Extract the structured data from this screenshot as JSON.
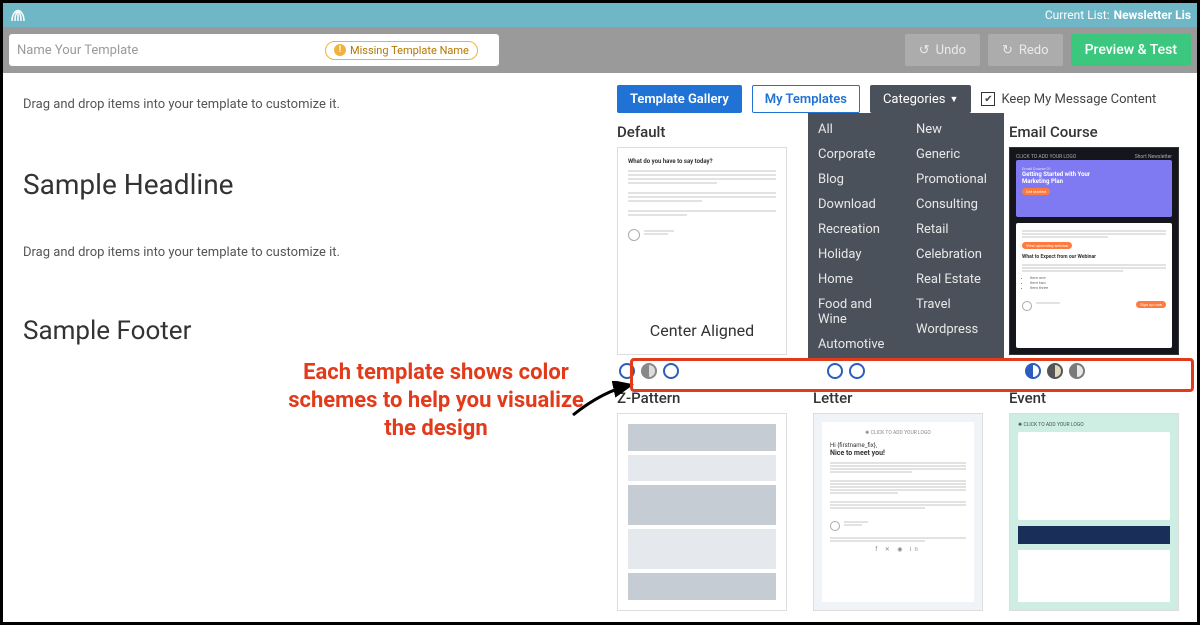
{
  "topbar": {
    "current_list_label": "Current List:",
    "current_list_value": "Newsletter Lis"
  },
  "actionbar": {
    "name_placeholder": "Name Your Template",
    "missing_label": "Missing Template Name",
    "undo": "Undo",
    "redo": "Redo",
    "preview": "Preview & Test"
  },
  "canvas": {
    "hint_top": "Drag and drop items into your template to customize it.",
    "headline": "Sample Headline",
    "hint_mid": "Drag and drop items into your template to customize it.",
    "footer": "Sample Footer"
  },
  "annotation": "Each template shows color schemes to help you visualize the design",
  "tabs": {
    "gallery": "Template Gallery",
    "my": "My Templates",
    "categories": "Categories"
  },
  "keep_label": "Keep My Message Content",
  "categories": [
    "All",
    "Corporate",
    "Blog",
    "Download",
    "Recreation",
    "Holiday",
    "Home",
    "Food and Wine",
    "Automotive",
    "New",
    "Generic",
    "Promotional",
    "Consulting",
    "Retail",
    "Celebration",
    "Real Estate",
    "Travel",
    "Wordpress"
  ],
  "templates": {
    "default": {
      "title": "Default",
      "caption": "Center Aligned",
      "micro_head": "What do you have to say today?"
    },
    "email": {
      "title": "Email Course",
      "hero": "Getting Started with Your Marketing Plan",
      "cta": "Sign up now",
      "logo": "CLICK TO ADD YOUR LOGO"
    },
    "zpattern": {
      "title": "Z-Pattern"
    },
    "letter": {
      "title": "Letter",
      "greet": "Hi {firstname_fix},",
      "lead": "Nice to meet you!",
      "logo": "CLICK TO ADD YOUR LOGO"
    },
    "event": {
      "title": "Event",
      "logo": "CLICK TO ADD YOUR LOGO"
    }
  }
}
